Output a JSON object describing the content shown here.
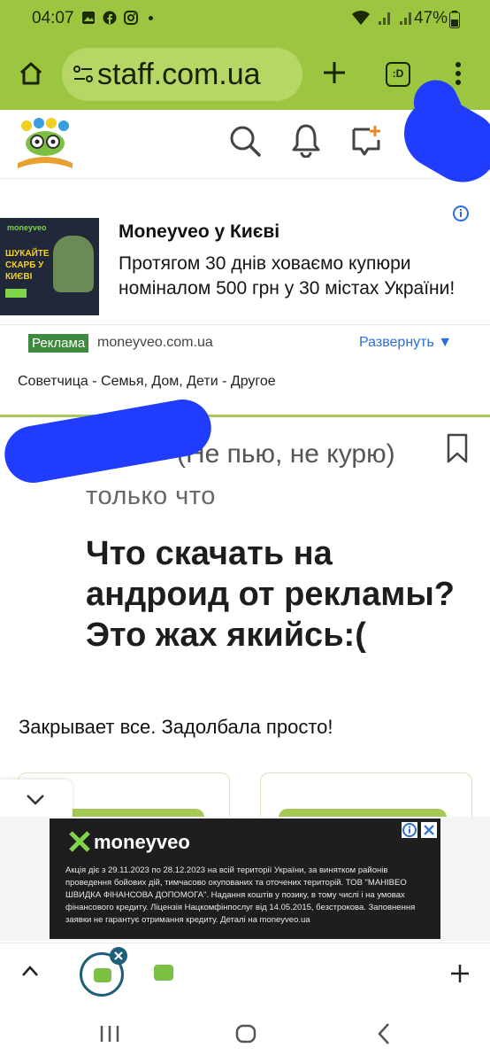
{
  "status": {
    "time": "04:07",
    "battery": "47%"
  },
  "browser": {
    "url": "staff.com.ua",
    "tab_switcher_label": ":D"
  },
  "ad": {
    "thumb_brand": "moneyveo",
    "thumb_headline": "ШУКАЙТЕ СКАРБ У КИЄВІ",
    "title": "Moneyveo у Києві",
    "description": "Протягом 30 днів ховаємо купюри номіналом 500 грн у 30 містах України!",
    "badge": "Реклама",
    "domain": "moneyveo.com.ua",
    "expand": "Развернуть ▼"
  },
  "breadcrumb": "Советчица - Семья, Дом, Дети - Другое",
  "post": {
    "author": "(Не пью, не курю)",
    "time": "только что",
    "title": "Что скачать на андроид от рекламы? Это жах якийсь:(",
    "body": "Закрывает все. Задолбала просто!"
  },
  "bottom_ad": {
    "brand": "moneyveo",
    "legal": "Акція діє з 29.11.2023 по 28.12.2023 на всій території України, за винятком районів проведення бойових дій, тимчасово окупованих та оточених територій. ТОВ \"МАНІВЕО ШВИДКА ФІНАНСОВА ДОПОМОГА\". Надання коштів у позику, в тому числі і на умовах фінансового кредиту. Ліцензія Нацкомфінпослуг від 14.05.2015, безстрокова. Заповнення заявки не гарантує отримання кредиту. Деталі на moneyveo.ua"
  },
  "colors": {
    "browser_green": "#9cc63f",
    "site_green": "#a4ca55",
    "link_blue": "#2a6ed6"
  }
}
